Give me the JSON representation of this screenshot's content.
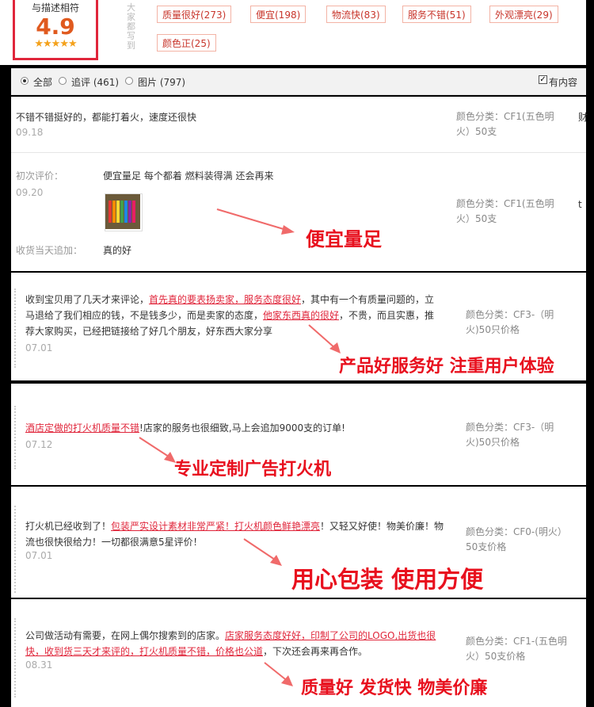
{
  "summary": {
    "caption": "与描述相符",
    "score": "4.9",
    "stars": "★★★★★",
    "vertical_label": "大家都写到",
    "tags": [
      "质量很好(273)",
      "便宜(198)",
      "物流快(83)",
      "服务不错(51)",
      "外观漂亮(29)",
      "颜色正(25)"
    ]
  },
  "filter": {
    "options": [
      "全部",
      "追评 (461)",
      "图片 (797)"
    ],
    "has_content_label": "有内容"
  },
  "reviews": [
    {
      "text": "不错不错挺好的，都能打着火，速度还很快",
      "date": "09.18",
      "variant": "颜色分类：CF1(五色明火）50支",
      "edge": "财"
    },
    {
      "initial_label": "初次评价：",
      "text": "便宜量足 每个都着 燃料装得满 还会再来",
      "date": "09.20",
      "followup_label": "收货当天追加：",
      "followup_text": "真的好",
      "variant": "颜色分类：CF1(五色明火）50支",
      "edge": "t",
      "callout": "便宜量足"
    },
    {
      "text_parts": [
        "收到宝贝用了几天才来评论，",
        "首先真的要表扬卖家，服务态度很好",
        "，其中有一个有质量问题的，立马退给了我们相应的钱，不是钱多少，而是卖家的态度，",
        "他家东西真的很好",
        "，不贵，而且实惠，推荐大家购买，已经把链接给了好几个朋友，好东西大家分享"
      ],
      "date": "07.01",
      "variant": "颜色分类：CF3-（明火)50只价格",
      "callout": "产品好服务好   注重用户体验"
    },
    {
      "text_parts": [
        "酒店定做的打火机质量不错",
        "!店家的服务也很细致,马上会追加9000支的订单!"
      ],
      "date": "07.12",
      "variant": "颜色分类：CF3-（明火)50只价格",
      "callout": "专业定制广告打火机"
    },
    {
      "text_parts": [
        "打火机已经收到了！",
        "包装严实设计素材非常严紧！打火机颜色鲜艳漂亮",
        "！又轻又好使！物美价廉！物流也很快很给力！一切都很满意5星评价！"
      ],
      "date": "07.01",
      "variant": "颜色分类：CF0-(明火）50支价格",
      "callout": "用心包装   使用方便"
    },
    {
      "text_parts": [
        "公司做活动有需要，在网上偶尔搜索到的店家。",
        "店家服务态度好好，印制了公司的LOGO,出货也很快，收到货三天才来评的，打火机质量不错，价格也公道",
        "，下次还会再来再合作。"
      ],
      "date": "08.31",
      "variant": "颜色分类：CF1-(五色明火）50支价格",
      "callout": "质量好   发货快   物美价廉"
    }
  ]
}
